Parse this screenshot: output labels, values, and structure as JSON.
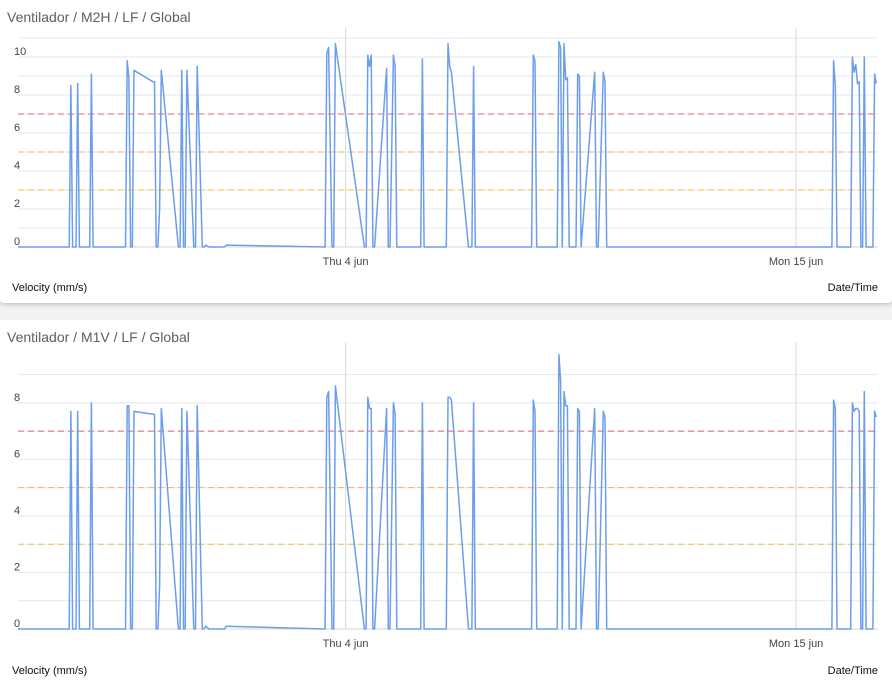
{
  "charts": [
    {
      "title": "Ventilador / M2H / LF / Global",
      "ylabel": "Velocity (mm/s)",
      "xlabel": "Date/Time"
    },
    {
      "title": "Ventilador / M1V / LF / Global",
      "ylabel": "Velocity (mm/s)",
      "xlabel": "Date/Time"
    }
  ],
  "chart_data": [
    {
      "type": "line",
      "title": "Ventilador / M2H / LF / Global",
      "xlabel": "Date/Time",
      "ylabel": "Velocity (mm/s)",
      "ylim": [
        0,
        11
      ],
      "xlim": [
        "2020-05-27",
        "2020-06-17"
      ],
      "grid": true,
      "y_ticks": [
        "0",
        "2",
        "4",
        "6",
        "8",
        "10"
      ],
      "x_ticks": [
        {
          "label": "Thu 4 jun",
          "date": "2020-06-04"
        },
        {
          "label": "Mon 15 jun",
          "date": "2020-06-15"
        }
      ],
      "thresholds": [
        {
          "value": 7,
          "color": "#e06666"
        },
        {
          "value": 5,
          "color": "#f6b26b"
        },
        {
          "value": 3,
          "color": "#f1c232"
        }
      ],
      "line_color": "#6d9eeb",
      "series": [
        {
          "x": [
            "2020-05-27 00:00",
            "2020-05-28 06:00",
            "2020-05-28 07:00",
            "2020-05-28 08:00",
            "2020-05-28 10:00",
            "2020-05-28 11:00",
            "2020-05-28 12:00",
            "2020-05-28 18:00",
            "2020-05-28 19:00",
            "2020-05-28 20:00",
            "2020-05-29 15:00",
            "2020-05-29 16:00",
            "2020-05-29 17:00",
            "2020-05-29 18:00",
            "2020-05-29 19:00",
            "2020-05-29 20:00",
            "2020-05-30 07:00",
            "2020-05-30 08:00",
            "2020-05-30 09:00",
            "2020-05-30 10:00",
            "2020-05-30 11:00",
            "2020-05-30 12:00",
            "2020-05-30 22:00",
            "2020-05-30 23:00",
            "2020-05-31 00:00",
            "2020-05-31 01:00",
            "2020-05-31 02:00",
            "2020-05-31 03:00",
            "2020-05-31 07:00",
            "2020-05-31 08:00",
            "2020-05-31 09:00",
            "2020-05-31 12:00",
            "2020-05-31 13:00",
            "2020-05-31 14:00",
            "2020-05-31 16:00",
            "2020-05-31 17:00",
            "2020-05-31 18:00",
            "2020-06-01 00:00",
            "2020-06-01 01:00",
            "2020-06-01 02:00",
            "2020-06-03 12:00",
            "2020-06-03 13:00",
            "2020-06-03 14:00",
            "2020-06-03 16:00",
            "2020-06-03 17:00",
            "2020-06-03 18:00",
            "2020-06-04 11:00",
            "2020-06-04 12:00",
            "2020-06-04 13:00",
            "2020-06-04 14:00",
            "2020-06-04 15:00",
            "2020-06-04 16:00",
            "2020-06-04 17:00",
            "2020-06-05 00:00",
            "2020-06-05 01:00",
            "2020-06-05 02:00",
            "2020-06-05 04:00",
            "2020-06-05 05:00",
            "2020-06-05 06:00",
            "2020-06-05 20:00",
            "2020-06-05 21:00",
            "2020-06-05 22:00",
            "2020-06-05 23:00",
            "2020-06-06 00:00",
            "2020-06-06 11:00",
            "2020-06-06 12:00",
            "2020-06-06 13:00",
            "2020-06-06 14:00",
            "2020-06-07 00:00",
            "2020-06-07 01:00",
            "2020-06-07 02:00",
            "2020-06-07 03:00",
            "2020-06-07 04:00",
            "2020-06-07 05:00",
            "2020-06-08 13:00",
            "2020-06-08 14:00",
            "2020-06-08 15:00",
            "2020-06-08 16:00",
            "2020-06-08 17:00",
            "2020-06-09 03:00",
            "2020-06-09 04:00",
            "2020-06-09 05:00",
            "2020-06-09 06:00",
            "2020-06-09 07:00",
            "2020-06-09 08:00",
            "2020-06-09 09:00",
            "2020-06-09 10:00",
            "2020-06-09 11:00",
            "2020-06-09 15:00",
            "2020-06-09 16:00",
            "2020-06-09 17:00",
            "2020-06-09 18:00",
            "2020-06-10 02:00",
            "2020-06-10 03:00",
            "2020-06-10 04:00",
            "2020-06-10 07:00",
            "2020-06-10 08:00",
            "2020-06-10 09:00",
            "2020-06-10 10:00",
            "2020-06-10 11:00",
            "2020-06-10 12:00",
            "2020-06-15 21:00",
            "2020-06-15 22:00",
            "2020-06-15 23:00",
            "2020-06-16 00:00",
            "2020-06-16 08:00",
            "2020-06-16 09:00",
            "2020-06-16 10:00",
            "2020-06-16 11:00",
            "2020-06-16 12:00",
            "2020-06-16 13:00",
            "2020-06-16 14:00",
            "2020-06-16 15:00",
            "2020-06-16 16:00",
            "2020-06-16 17:00",
            "2020-06-16 20:00",
            "2020-06-16 21:00",
            "2020-06-16 22:00",
            "2020-06-16 23:00"
          ],
          "y": [
            0,
            0,
            8.5,
            0,
            0,
            8.6,
            0,
            0,
            9.1,
            0,
            0,
            9.8,
            8.9,
            0,
            0,
            9.3,
            8.7,
            8.7,
            0,
            0,
            2,
            9.3,
            0,
            0,
            9.3,
            0,
            0,
            9.3,
            0,
            0,
            9.5,
            0,
            0,
            0.1,
            0,
            0,
            0,
            0,
            0,
            0.1,
            0,
            10.2,
            10.5,
            0,
            0,
            10.7,
            0,
            0,
            10.1,
            9.5,
            10.1,
            0,
            0,
            9.4,
            0,
            0,
            10.1,
            9.5,
            0,
            0,
            9.9,
            0,
            0,
            0,
            0,
            10.7,
            9.5,
            9.2,
            0,
            0,
            0,
            9.5,
            0,
            0,
            0,
            10.1,
            9.8,
            0,
            0,
            0,
            0,
            10.8,
            10.5,
            0,
            10.7,
            8.8,
            8.9,
            0,
            0,
            9.1,
            9.0,
            0,
            9.2,
            0,
            0,
            9.2,
            8.7,
            0,
            0,
            0,
            0,
            0,
            9.8,
            8.5,
            0,
            0,
            10.0,
            9.2,
            9.6,
            8.6,
            8.7,
            0,
            0,
            10.0,
            0,
            0,
            0,
            9.1,
            8.6
          ]
        }
      ]
    },
    {
      "type": "line",
      "title": "Ventilador / M1V / LF / Global",
      "xlabel": "Date/Time",
      "ylabel": "Velocity (mm/s)",
      "ylim": [
        0,
        9.8
      ],
      "xlim": [
        "2020-05-27",
        "2020-06-17"
      ],
      "grid": true,
      "y_ticks": [
        "0",
        "2",
        "4",
        "6",
        "8"
      ],
      "x_ticks": [
        {
          "label": "Thu 4 jun",
          "date": "2020-06-04"
        },
        {
          "label": "Mon 15 jun",
          "date": "2020-06-15"
        }
      ],
      "thresholds": [
        {
          "value": 7,
          "color": "#e06666"
        },
        {
          "value": 5,
          "color": "#f6b26b"
        },
        {
          "value": 3,
          "color": "#f1c232"
        }
      ],
      "line_color": "#6d9eeb",
      "series": [
        {
          "x": [
            "2020-05-27 00:00",
            "2020-05-28 06:00",
            "2020-05-28 07:00",
            "2020-05-28 08:00",
            "2020-05-28 10:00",
            "2020-05-28 11:00",
            "2020-05-28 12:00",
            "2020-05-28 18:00",
            "2020-05-28 19:00",
            "2020-05-28 20:00",
            "2020-05-29 15:00",
            "2020-05-29 16:00",
            "2020-05-29 17:00",
            "2020-05-29 18:00",
            "2020-05-29 19:00",
            "2020-05-29 20:00",
            "2020-05-30 07:00",
            "2020-05-30 08:00",
            "2020-05-30 09:00",
            "2020-05-30 10:00",
            "2020-05-30 11:00",
            "2020-05-30 12:00",
            "2020-05-30 22:00",
            "2020-05-30 23:00",
            "2020-05-31 00:00",
            "2020-05-31 01:00",
            "2020-05-31 02:00",
            "2020-05-31 03:00",
            "2020-05-31 07:00",
            "2020-05-31 08:00",
            "2020-05-31 09:00",
            "2020-05-31 12:00",
            "2020-05-31 13:00",
            "2020-05-31 14:00",
            "2020-05-31 16:00",
            "2020-05-31 17:00",
            "2020-05-31 18:00",
            "2020-06-01 00:00",
            "2020-06-01 01:00",
            "2020-06-01 02:00",
            "2020-06-03 12:00",
            "2020-06-03 13:00",
            "2020-06-03 14:00",
            "2020-06-03 16:00",
            "2020-06-03 17:00",
            "2020-06-03 18:00",
            "2020-06-04 11:00",
            "2020-06-04 12:00",
            "2020-06-04 13:00",
            "2020-06-04 14:00",
            "2020-06-04 15:00",
            "2020-06-04 16:00",
            "2020-06-04 17:00",
            "2020-06-05 00:00",
            "2020-06-05 01:00",
            "2020-06-05 02:00",
            "2020-06-05 04:00",
            "2020-06-05 05:00",
            "2020-06-05 06:00",
            "2020-06-05 20:00",
            "2020-06-05 21:00",
            "2020-06-05 22:00",
            "2020-06-05 23:00",
            "2020-06-06 00:00",
            "2020-06-06 11:00",
            "2020-06-06 12:00",
            "2020-06-06 13:00",
            "2020-06-06 14:00",
            "2020-06-07 00:00",
            "2020-06-07 01:00",
            "2020-06-07 02:00",
            "2020-06-07 03:00",
            "2020-06-07 04:00",
            "2020-06-07 05:00",
            "2020-06-08 13:00",
            "2020-06-08 14:00",
            "2020-06-08 15:00",
            "2020-06-08 16:00",
            "2020-06-08 17:00",
            "2020-06-09 03:00",
            "2020-06-09 04:00",
            "2020-06-09 05:00",
            "2020-06-09 06:00",
            "2020-06-09 07:00",
            "2020-06-09 08:00",
            "2020-06-09 09:00",
            "2020-06-09 10:00",
            "2020-06-09 11:00",
            "2020-06-09 15:00",
            "2020-06-09 16:00",
            "2020-06-09 17:00",
            "2020-06-09 18:00",
            "2020-06-10 02:00",
            "2020-06-10 03:00",
            "2020-06-10 04:00",
            "2020-06-10 07:00",
            "2020-06-10 08:00",
            "2020-06-10 09:00",
            "2020-06-10 10:00",
            "2020-06-10 11:00",
            "2020-06-10 12:00",
            "2020-06-15 21:00",
            "2020-06-15 22:00",
            "2020-06-15 23:00",
            "2020-06-16 00:00",
            "2020-06-16 08:00",
            "2020-06-16 09:00",
            "2020-06-16 10:00",
            "2020-06-16 11:00",
            "2020-06-16 12:00",
            "2020-06-16 13:00",
            "2020-06-16 14:00",
            "2020-06-16 15:00",
            "2020-06-16 16:00",
            "2020-06-16 17:00",
            "2020-06-16 20:00",
            "2020-06-16 21:00",
            "2020-06-16 22:00",
            "2020-06-16 23:00"
          ],
          "y": [
            0,
            0,
            7.7,
            0,
            0,
            7.7,
            0,
            0,
            8.0,
            0,
            0,
            7.9,
            7.9,
            0,
            0,
            7.7,
            7.6,
            7.6,
            0,
            0,
            1.5,
            7.8,
            0,
            0,
            7.8,
            0,
            0,
            7.7,
            0,
            0,
            7.9,
            0,
            0,
            0.1,
            0,
            0,
            0,
            0,
            0,
            0.1,
            0,
            8.2,
            8.4,
            0,
            0,
            8.6,
            0,
            0,
            8.2,
            7.8,
            7.8,
            0,
            0,
            7.8,
            0,
            0,
            8.0,
            7.6,
            0,
            0,
            8.0,
            0,
            0,
            0,
            0,
            8.2,
            8.2,
            8.1,
            0,
            0,
            0,
            8.0,
            0,
            0,
            0,
            8.1,
            7.7,
            0,
            0,
            0,
            0,
            9.7,
            8.8,
            0,
            8.4,
            7.9,
            7.9,
            0,
            0,
            7.8,
            7.7,
            0,
            7.8,
            0,
            0,
            7.7,
            7.5,
            0,
            0,
            0,
            0,
            0,
            8.1,
            7.8,
            0,
            0,
            8.0,
            7.7,
            7.8,
            7.8,
            7.7,
            0,
            0,
            8.4,
            0,
            0,
            0,
            7.7,
            7.5
          ]
        }
      ]
    }
  ]
}
